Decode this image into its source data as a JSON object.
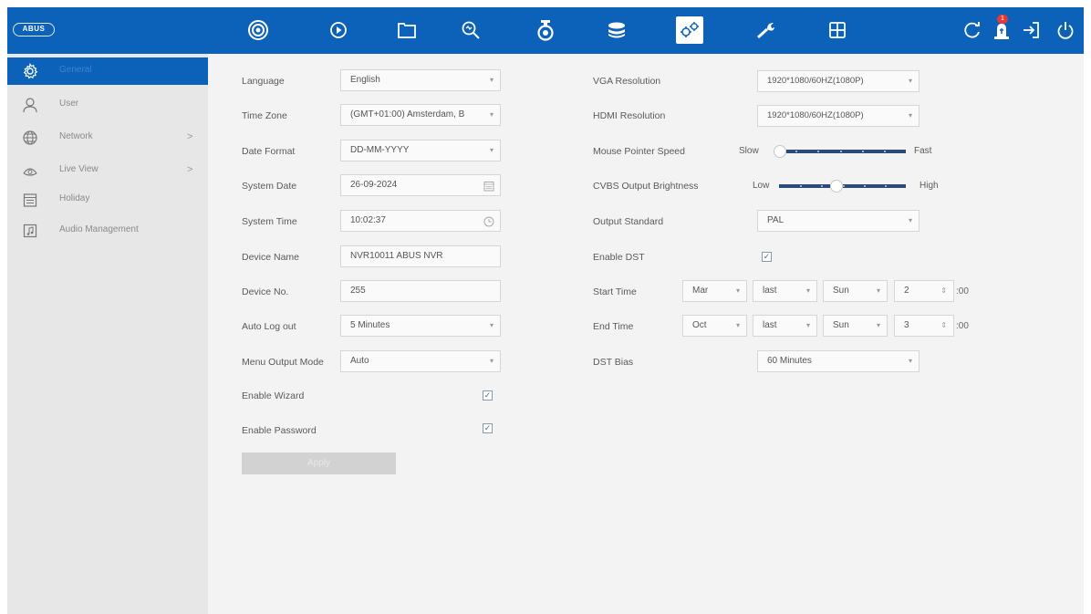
{
  "brand": {
    "logo_text": "ABUS"
  },
  "topbar": {
    "icons": [
      {
        "name": "live-view-icon"
      },
      {
        "name": "playback-icon"
      },
      {
        "name": "file-management-icon"
      },
      {
        "name": "smart-search-icon"
      },
      {
        "name": "camera-icon"
      },
      {
        "name": "storage-icon"
      },
      {
        "name": "system-config-icon"
      },
      {
        "name": "maintenance-icon"
      },
      {
        "name": "layout-icon"
      }
    ],
    "right_icons": [
      {
        "name": "refresh-icon"
      },
      {
        "name": "alarm-icon",
        "badge": "1"
      },
      {
        "name": "logout-icon"
      },
      {
        "name": "power-icon"
      }
    ],
    "accent_color": "#0c62b8"
  },
  "sidebar": {
    "items": [
      {
        "label": "General",
        "icon": "gear-icon",
        "active": true
      },
      {
        "label": "User",
        "icon": "user-icon"
      },
      {
        "label": "Network",
        "icon": "globe-icon",
        "has_children": true
      },
      {
        "label": "Live View",
        "icon": "eye-icon",
        "has_children": true
      },
      {
        "label": "Holiday",
        "icon": "calendar-icon"
      },
      {
        "label": "Audio Management",
        "icon": "music-icon"
      }
    ],
    "chevron": ">"
  },
  "form_left": {
    "language": {
      "label": "Language",
      "value": "English"
    },
    "time_zone": {
      "label": "Time Zone",
      "value": "(GMT+01:00) Amsterdam, B"
    },
    "date_format": {
      "label": "Date Format",
      "value": "DD-MM-YYYY"
    },
    "system_date": {
      "label": "System Date",
      "value": "26-09-2024"
    },
    "system_time": {
      "label": "System Time",
      "value": "10:02:37"
    },
    "device_name": {
      "label": "Device Name",
      "value": "NVR10011 ABUS NVR"
    },
    "device_no": {
      "label": "Device No.",
      "value": "255"
    },
    "auto_logout": {
      "label": "Auto Log out",
      "value": "5 Minutes"
    },
    "menu_output_mode": {
      "label": "Menu Output Mode",
      "value": "Auto"
    },
    "enable_wizard": {
      "label": "Enable Wizard",
      "checked": true
    },
    "enable_password": {
      "label": "Enable Password",
      "checked": true
    },
    "apply_label": "Apply"
  },
  "form_right": {
    "vga_resolution": {
      "label": "VGA Resolution",
      "value": "1920*1080/60HZ(1080P)"
    },
    "hdmi_resolution": {
      "label": "HDMI Resolution",
      "value": "1920*1080/60HZ(1080P)"
    },
    "mouse_speed": {
      "label": "Mouse Pointer Speed",
      "min_label": "Slow",
      "max_label": "Fast",
      "level": 0.0
    },
    "cvbs_brightness": {
      "label": "CVBS Output Brightness",
      "min_label": "Low",
      "max_label": "High",
      "level": 0.45
    },
    "output_standard": {
      "label": "Output Standard",
      "value": "PAL"
    },
    "enable_dst": {
      "label": "Enable DST",
      "checked": true
    },
    "start_time": {
      "label": "Start Time",
      "month": "Mar",
      "week": "last",
      "day": "Sun",
      "hour": "2",
      "minutes": ":00"
    },
    "end_time": {
      "label": "End Time",
      "month": "Oct",
      "week": "last",
      "day": "Sun",
      "hour": "3",
      "minutes": ":00"
    },
    "dst_bias": {
      "label": "DST Bias",
      "value": "60 Minutes"
    }
  },
  "dropdown_arrow": "▾",
  "spin_arrow": "⇕",
  "check_mark": "✓"
}
